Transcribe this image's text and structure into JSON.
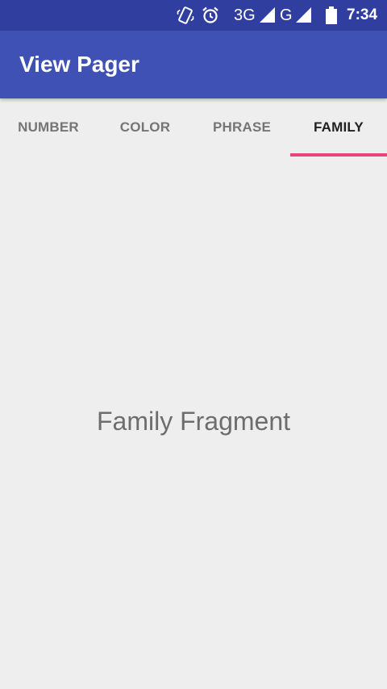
{
  "status_bar": {
    "network_3g": "3G",
    "network_g": "G",
    "time": "7:34",
    "icons": [
      "vibrate-icon",
      "alarm-icon",
      "signal-3g-icon",
      "signal-g-icon",
      "battery-icon"
    ]
  },
  "app_bar": {
    "title": "View Pager"
  },
  "tabs": [
    {
      "label": "NUMBER"
    },
    {
      "label": "COLOR"
    },
    {
      "label": "PHRASE"
    },
    {
      "label": "FAMILY"
    }
  ],
  "active_tab": "FAMILY",
  "content": {
    "text": "Family Fragment"
  },
  "colors": {
    "status_bar": "#303f9f",
    "app_bar": "#3f51b5",
    "tab_indicator": "#e8457c",
    "background": "#eeeeee"
  }
}
